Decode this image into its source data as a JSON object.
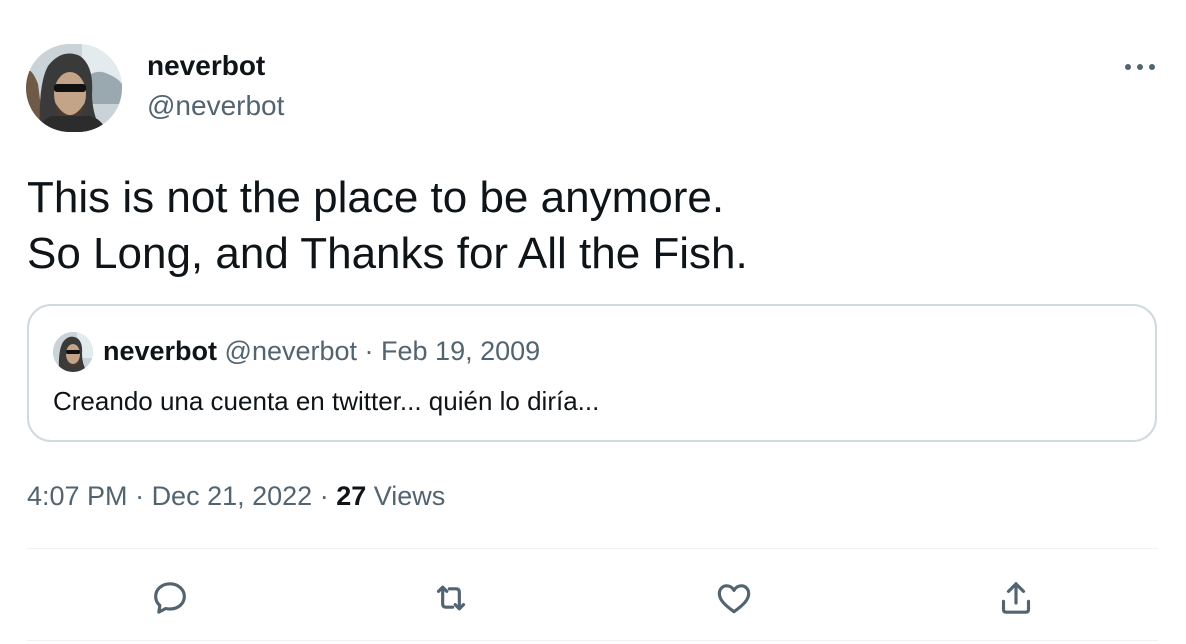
{
  "author": {
    "name": "neverbot",
    "handle": "@neverbot"
  },
  "tweet": {
    "lines": [
      "This is not the place to be anymore.",
      "So Long, and Thanks for All the Fish."
    ]
  },
  "quote": {
    "name": "neverbot",
    "handle": "@neverbot",
    "separator": " · ",
    "date": "Feb 19, 2009",
    "text": "Creando una cuenta en twitter... quién lo diría..."
  },
  "meta": {
    "time": "4:07 PM",
    "separator": " · ",
    "date": "Dec 21, 2022",
    "views_count": "27",
    "views_label": "Views"
  },
  "icons": {
    "more": "more-horizontal-icon",
    "reply": "reply-icon",
    "retweet": "retweet-icon",
    "like": "like-icon",
    "share": "share-icon"
  },
  "colors": {
    "text_primary": "#0f1419",
    "text_secondary": "#536471",
    "border": "#cfd9de",
    "divider": "#eff3f4"
  }
}
